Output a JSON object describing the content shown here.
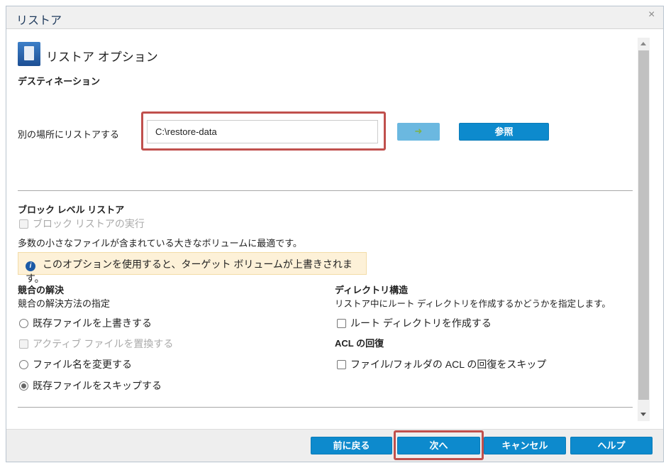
{
  "window": {
    "title": "リストア",
    "close_icon": "×"
  },
  "header": {
    "title": "リストア オプション",
    "section": "デスティネーション"
  },
  "destination": {
    "label": "別の場所にリストアする",
    "path_value": "C:\\restore-data",
    "go_icon": "➜",
    "browse_label": "参照"
  },
  "block": {
    "heading": "ブロック レベル リストア",
    "checkbox_label": "ブロック リストアの実行",
    "description": "多数の小さなファイルが含まれている大きなボリュームに最適です。",
    "info_icon": "i",
    "warning": "このオプションを使用すると、ターゲット ボリュームが上書きされます。"
  },
  "conflict": {
    "heading": "競合の解決",
    "subheading": "競合の解決方法の指定",
    "options": [
      {
        "label": "既存ファイルを上書きする",
        "type": "radio",
        "checked": false,
        "disabled": false
      },
      {
        "label": "アクティブ ファイルを置換する",
        "type": "checkbox",
        "checked": false,
        "disabled": true
      },
      {
        "label": "ファイル名を変更する",
        "type": "radio",
        "checked": false,
        "disabled": false
      },
      {
        "label": "既存ファイルをスキップする",
        "type": "radio",
        "checked": true,
        "disabled": false
      }
    ]
  },
  "directory": {
    "heading": "ディレクトリ構造",
    "description": "リストア中にルート ディレクトリを作成するかどうかを指定します。",
    "checkbox_label": "ルート ディレクトリを作成する"
  },
  "acl": {
    "heading": "ACL の回復",
    "checkbox_label": "ファイル/フォルダの ACL の回復をスキップ"
  },
  "footer": {
    "back": "前に戻る",
    "next": "次へ",
    "cancel": "キャンセル",
    "help": "ヘルプ"
  },
  "colors": {
    "accent": "#0d8acd",
    "highlight": "#c0504d",
    "warning_bg": "#fdf1d8"
  }
}
